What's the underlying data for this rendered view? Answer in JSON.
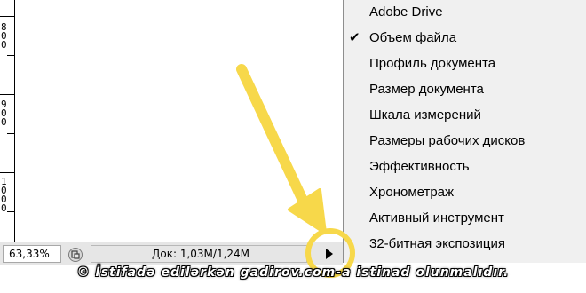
{
  "ruler": {
    "labels": [
      "800",
      "900",
      "1000"
    ]
  },
  "statusbar": {
    "zoom": "63,33%",
    "doc_info": "Док: 1,03M/1,24M"
  },
  "menu": {
    "items": [
      {
        "label": "Adobe Drive",
        "checked": false
      },
      {
        "label": "Объем файла",
        "checked": true
      },
      {
        "label": "Профиль документа",
        "checked": false
      },
      {
        "label": "Размер документа",
        "checked": false
      },
      {
        "label": "Шкала измерений",
        "checked": false
      },
      {
        "label": "Размеры рабочих дисков",
        "checked": false
      },
      {
        "label": "Эффективность",
        "checked": false
      },
      {
        "label": "Хронометраж",
        "checked": false
      },
      {
        "label": "Активный инструмент",
        "checked": false
      },
      {
        "label": "32-битная экспозиция",
        "checked": false
      }
    ],
    "check_mark": "✔"
  },
  "watermark": "© İstifadə edilərkən gadirov.com-a istinad olunmalıdır.",
  "colors": {
    "highlight": "#f7d84a",
    "menu_bg": "#f0f0f0",
    "statusbar_bg": "#e6e6e6"
  }
}
